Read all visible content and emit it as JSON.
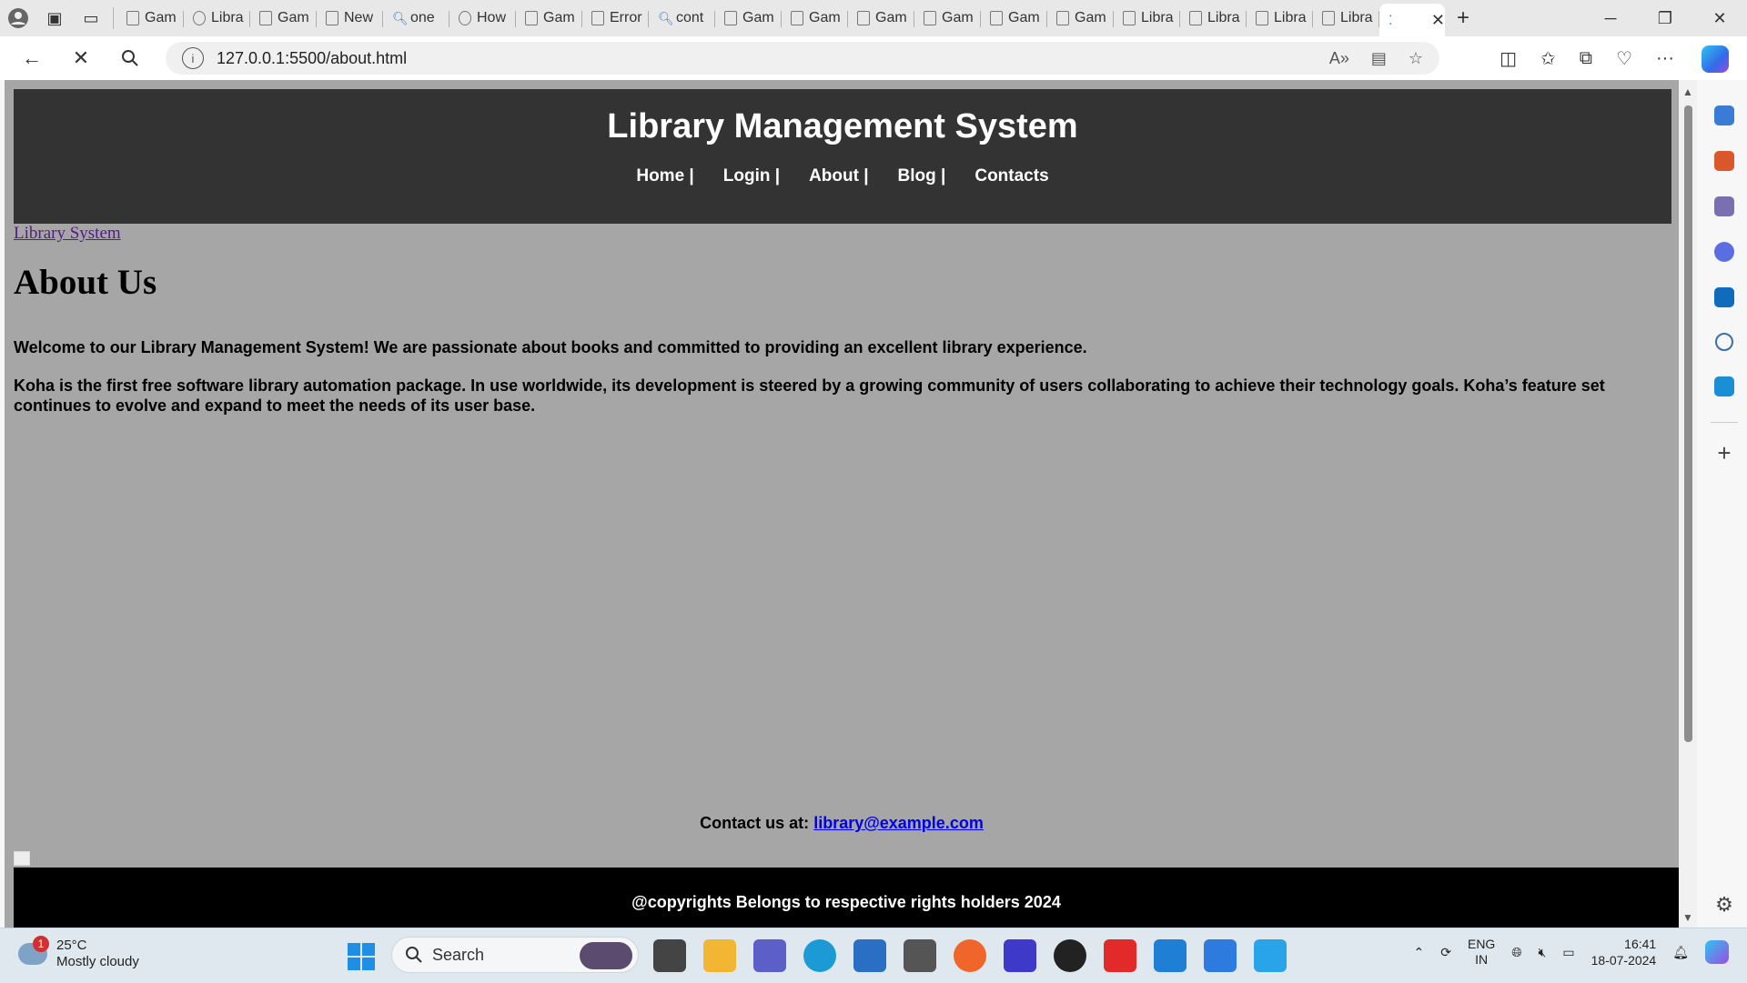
{
  "browser": {
    "tabs": [
      {
        "label": "Gam",
        "icon": "page-icon"
      },
      {
        "label": "Libra",
        "icon": "globe-icon"
      },
      {
        "label": "Gam",
        "icon": "page-icon"
      },
      {
        "label": "New",
        "icon": "newtab-icon"
      },
      {
        "label": "one",
        "icon": "search-icon"
      },
      {
        "label": "How",
        "icon": "cloud-icon"
      },
      {
        "label": "Gam",
        "icon": "page-icon"
      },
      {
        "label": "Error",
        "icon": "page-icon"
      },
      {
        "label": "cont",
        "icon": "search-icon"
      },
      {
        "label": "Gam",
        "icon": "page-icon"
      },
      {
        "label": "Gam",
        "icon": "page-icon"
      },
      {
        "label": "Gam",
        "icon": "page-icon"
      },
      {
        "label": "Gam",
        "icon": "page-icon"
      },
      {
        "label": "Gam",
        "icon": "page-icon"
      },
      {
        "label": "Gam",
        "icon": "page-icon"
      },
      {
        "label": "Libra",
        "icon": "page-icon"
      },
      {
        "label": "Libra",
        "icon": "page-icon"
      },
      {
        "label": "Libra",
        "icon": "page-icon"
      },
      {
        "label": "Libra",
        "icon": "page-icon"
      }
    ],
    "active_tab_loading": true,
    "url": "127.0.0.1:5500/about.html"
  },
  "site": {
    "title": "Library Management System",
    "nav": [
      "Home |",
      "Login |",
      "About |",
      "Blog |",
      "Contacts"
    ],
    "home_link": "Library System",
    "heading": "About Us",
    "paragraph1": "Welcome to our Library Management System! We are passionate about books and committed to providing an excellent library experience.",
    "paragraph2": "Koha is the first free software library automation package. In use worldwide, its development is steered by a growing community of users collaborating to achieve their technology goals. Koha’s feature set continues to evolve and expand to meet the needs of its user base.",
    "contact_label": "Contact us at:",
    "contact_email": "library@example.com",
    "footer": "@copyrights Belongs to respective rights holders 2024"
  },
  "taskbar": {
    "weather_temp": "25°C",
    "weather_desc": "Mostly cloudy",
    "weather_badge": "1",
    "search_placeholder": "Search",
    "lang_top": "ENG",
    "lang_bottom": "IN",
    "time": "16:41",
    "date": "18-07-2024"
  },
  "colors": {
    "header_bg": "#333333",
    "page_bg": "#a6a6a6",
    "footer_bg": "#000000"
  }
}
